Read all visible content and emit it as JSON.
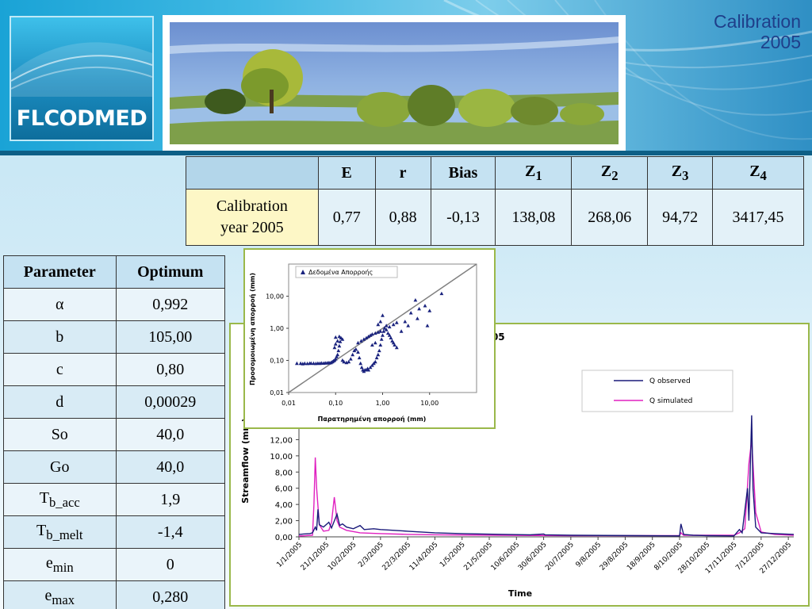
{
  "header": {
    "logo_text": "FLCODMED",
    "title_line1": "Calibration",
    "title_line2": "2005"
  },
  "stats_table": {
    "headers": [
      "E",
      "r",
      "Bias",
      "Z",
      "Z",
      "Z",
      "Z"
    ],
    "header_subscripts": [
      "",
      "",
      "",
      "1",
      "2",
      "3",
      "4"
    ],
    "row_label_line1": "Calibration",
    "row_label_line2": "year 2005",
    "values": [
      "0,77",
      "0,88",
      "-0,13",
      "138,08",
      "268,06",
      "94,72",
      "3417,45"
    ]
  },
  "param_table": {
    "headers": [
      "Parameter",
      "Optimum"
    ],
    "rows": [
      {
        "name": "α",
        "sub": "",
        "value": "0,992"
      },
      {
        "name": "b",
        "sub": "",
        "value": "105,00"
      },
      {
        "name": "c",
        "sub": "",
        "value": "0,80"
      },
      {
        "name": "d",
        "sub": "",
        "value": "0,00029"
      },
      {
        "name": "So",
        "sub": "",
        "value": "40,0"
      },
      {
        "name": "Go",
        "sub": "",
        "value": "40,0"
      },
      {
        "name": "T",
        "sub": "b_acc",
        "value": "1,9"
      },
      {
        "name": "T",
        "sub": "b_melt",
        "value": "-1,4"
      },
      {
        "name": "e",
        "sub": "min",
        "value": "0"
      },
      {
        "name": "e",
        "sub": "max",
        "value": "0,280"
      }
    ]
  },
  "chart_data": [
    {
      "type": "scatter",
      "title": "",
      "xlabel": "Παρατηρημένη απορροή (mm)",
      "ylabel": "Προσομοιωμένη απορροή (mm)",
      "log_x": true,
      "log_y": true,
      "xlim": [
        0.01,
        100
      ],
      "ylim": [
        0.01,
        100
      ],
      "x_tick_labels": [
        "0,01",
        "0,10",
        "1,00",
        "10,00"
      ],
      "y_tick_labels": [
        "0,01",
        "0,10",
        "1,00",
        "10,00"
      ],
      "legend": [
        "Δεδομένα Απορροής"
      ],
      "legend_position": "top-left",
      "marker_color": "#1a237e",
      "line_color": "#808080",
      "points": [
        [
          0.015,
          0.08
        ],
        [
          0.018,
          0.08
        ],
        [
          0.02,
          0.078
        ],
        [
          0.022,
          0.08
        ],
        [
          0.025,
          0.079
        ],
        [
          0.028,
          0.08
        ],
        [
          0.03,
          0.081
        ],
        [
          0.034,
          0.08
        ],
        [
          0.038,
          0.079
        ],
        [
          0.042,
          0.081
        ],
        [
          0.046,
          0.08
        ],
        [
          0.05,
          0.082
        ],
        [
          0.055,
          0.081
        ],
        [
          0.06,
          0.083
        ],
        [
          0.065,
          0.082
        ],
        [
          0.07,
          0.084
        ],
        [
          0.075,
          0.083
        ],
        [
          0.08,
          0.085
        ],
        [
          0.085,
          0.09
        ],
        [
          0.09,
          0.095
        ],
        [
          0.095,
          0.1
        ],
        [
          0.1,
          0.11
        ],
        [
          0.105,
          0.13
        ],
        [
          0.11,
          0.15
        ],
        [
          0.115,
          0.2
        ],
        [
          0.12,
          0.28
        ],
        [
          0.125,
          0.38
        ],
        [
          0.13,
          0.5
        ],
        [
          0.14,
          0.45
        ],
        [
          0.11,
          0.4
        ],
        [
          0.1,
          0.32
        ],
        [
          0.095,
          0.25
        ],
        [
          0.1,
          0.52
        ],
        [
          0.12,
          0.55
        ],
        [
          0.14,
          0.1
        ],
        [
          0.15,
          0.09
        ],
        [
          0.17,
          0.085
        ],
        [
          0.19,
          0.09
        ],
        [
          0.21,
          0.11
        ],
        [
          0.23,
          0.15
        ],
        [
          0.25,
          0.2
        ],
        [
          0.27,
          0.22
        ],
        [
          0.3,
          0.18
        ],
        [
          0.32,
          0.12
        ],
        [
          0.34,
          0.08
        ],
        [
          0.36,
          0.06
        ],
        [
          0.38,
          0.05
        ],
        [
          0.4,
          0.045
        ],
        [
          0.42,
          0.05
        ],
        [
          0.45,
          0.05
        ],
        [
          0.48,
          0.055
        ],
        [
          0.5,
          0.05
        ],
        [
          0.55,
          0.06
        ],
        [
          0.6,
          0.07
        ],
        [
          0.65,
          0.08
        ],
        [
          0.7,
          0.09
        ],
        [
          0.75,
          0.12
        ],
        [
          0.8,
          0.15
        ],
        [
          0.85,
          0.2
        ],
        [
          0.9,
          0.3
        ],
        [
          0.95,
          0.45
        ],
        [
          1.0,
          0.6
        ],
        [
          1.05,
          0.8
        ],
        [
          1.1,
          1.0
        ],
        [
          1.2,
          0.9
        ],
        [
          1.3,
          0.7
        ],
        [
          1.4,
          0.6
        ],
        [
          1.5,
          0.5
        ],
        [
          1.6,
          0.4
        ],
        [
          1.7,
          0.35
        ],
        [
          1.8,
          0.3
        ],
        [
          2.0,
          0.25
        ],
        [
          0.3,
          0.35
        ],
        [
          0.35,
          0.4
        ],
        [
          0.4,
          0.45
        ],
        [
          0.45,
          0.5
        ],
        [
          0.5,
          0.55
        ],
        [
          0.55,
          0.6
        ],
        [
          0.6,
          0.65
        ],
        [
          0.7,
          0.7
        ],
        [
          0.8,
          0.75
        ],
        [
          0.9,
          0.8
        ],
        [
          0.6,
          0.3
        ],
        [
          0.7,
          0.35
        ],
        [
          1.2,
          1.2
        ],
        [
          1.4,
          1.1
        ],
        [
          1.7,
          1.3
        ],
        [
          2.0,
          1.5
        ],
        [
          2.5,
          0.8
        ],
        [
          3.0,
          1.6
        ],
        [
          3.5,
          1.2
        ],
        [
          4.0,
          3.0
        ],
        [
          5.0,
          7.5
        ],
        [
          5.5,
          2.0
        ],
        [
          6.0,
          4.0
        ],
        [
          8.0,
          5.0
        ],
        [
          9.0,
          1.2
        ],
        [
          10.0,
          3.5
        ],
        [
          18.0,
          12.0
        ],
        [
          1.0,
          2.5
        ],
        [
          0.9,
          1.6
        ],
        [
          0.8,
          1.3
        ]
      ]
    },
    {
      "type": "line",
      "title": "tershed - Calibration year 2005",
      "xlabel": "Time",
      "ylabel": "Streamflow (mm)",
      "ylim": [
        0,
        14
      ],
      "y_tick_labels": [
        "0,00",
        "2,00",
        "4,00",
        "6,00",
        "8,00",
        "10,00",
        "12,00"
      ],
      "legend_position": "top-right",
      "x_dates": [
        "1/1/2005",
        "21/1/2005",
        "10/2/2005",
        "2/3/2005",
        "22/3/2005",
        "11/4/2005",
        "1/5/2005",
        "21/5/2005",
        "10/6/2005",
        "30/6/2005",
        "20/7/2005",
        "9/8/2005",
        "29/8/2005",
        "18/9/2005",
        "8/10/2005",
        "28/10/2005",
        "17/11/2005",
        "7/12/2005",
        "27/12/2005"
      ],
      "series": [
        {
          "name": "Q observed",
          "color": "#1a1a7a",
          "points": [
            [
              0,
              0.3
            ],
            [
              8,
              0.4
            ],
            [
              10,
              0.5
            ],
            [
              12,
              1.2
            ],
            [
              13,
              0.8
            ],
            [
              14,
              3.4
            ],
            [
              15,
              1.5
            ],
            [
              18,
              1.2
            ],
            [
              22,
              1.8
            ],
            [
              24,
              1.1
            ],
            [
              28,
              2.8
            ],
            [
              30,
              1.4
            ],
            [
              32,
              1.6
            ],
            [
              35,
              1.2
            ],
            [
              40,
              1.0
            ],
            [
              45,
              1.4
            ],
            [
              48,
              0.9
            ],
            [
              55,
              1.0
            ],
            [
              60,
              0.9
            ],
            [
              70,
              0.8
            ],
            [
              80,
              0.7
            ],
            [
              90,
              0.6
            ],
            [
              100,
              0.5
            ],
            [
              110,
              0.45
            ],
            [
              120,
              0.4
            ],
            [
              150,
              0.3
            ],
            [
              170,
              0.25
            ],
            [
              180,
              0.35
            ],
            [
              181,
              0.25
            ],
            [
              200,
              0.2
            ],
            [
              250,
              0.15
            ],
            [
              280,
              0.12
            ],
            [
              281,
              1.6
            ],
            [
              283,
              0.3
            ],
            [
              290,
              0.2
            ],
            [
              300,
              0.15
            ],
            [
              320,
              0.12
            ],
            [
              324,
              0.9
            ],
            [
              326,
              0.5
            ],
            [
              330,
              6.0
            ],
            [
              331,
              2.0
            ],
            [
              333,
              15.0
            ],
            [
              334,
              6.0
            ],
            [
              336,
              1.2
            ],
            [
              340,
              0.5
            ],
            [
              350,
              0.4
            ],
            [
              364,
              0.3
            ]
          ]
        },
        {
          "name": "Q simulated",
          "color": "#e020c0",
          "points": [
            [
              0,
              0.1
            ],
            [
              10,
              0.2
            ],
            [
              11,
              4.0
            ],
            [
              12,
              9.8
            ],
            [
              13,
              6.0
            ],
            [
              15,
              1.5
            ],
            [
              18,
              0.7
            ],
            [
              22,
              0.8
            ],
            [
              24,
              1.8
            ],
            [
              26,
              4.9
            ],
            [
              28,
              2.0
            ],
            [
              30,
              1.2
            ],
            [
              35,
              0.8
            ],
            [
              45,
              0.5
            ],
            [
              60,
              0.4
            ],
            [
              80,
              0.3
            ],
            [
              100,
              0.25
            ],
            [
              150,
              0.2
            ],
            [
              200,
              0.15
            ],
            [
              280,
              0.15
            ],
            [
              281,
              0.5
            ],
            [
              283,
              0.2
            ],
            [
              320,
              0.2
            ],
            [
              324,
              0.5
            ],
            [
              328,
              1.0
            ],
            [
              331,
              9.0
            ],
            [
              333,
              12.0
            ],
            [
              334,
              9.0
            ],
            [
              336,
              3.0
            ],
            [
              340,
              0.6
            ],
            [
              350,
              0.3
            ],
            [
              364,
              0.2
            ]
          ]
        }
      ]
    }
  ]
}
